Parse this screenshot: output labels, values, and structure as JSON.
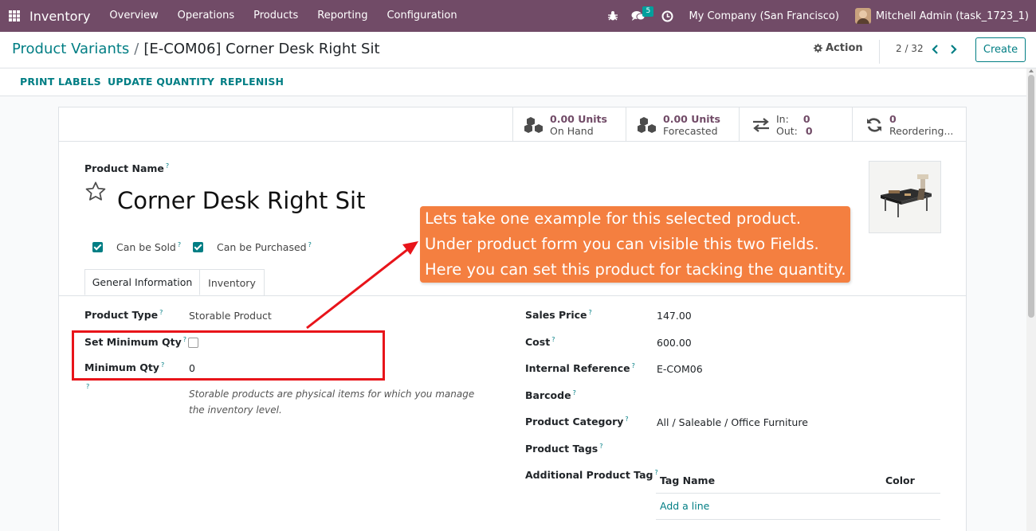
{
  "navbar": {
    "app_name": "Inventory",
    "menu": [
      "Overview",
      "Operations",
      "Products",
      "Reporting",
      "Configuration"
    ],
    "messages_count": "5",
    "company": "My Company (San Francisco)",
    "user": "Mitchell Admin (task_1723_1)"
  },
  "control_panel": {
    "breadcrumb_parent": "Product Variants",
    "breadcrumb_sep": "/",
    "breadcrumb_current": "[E-COM06] Corner Desk Right Sit",
    "action_label": "Action",
    "pager": "2 / 32",
    "create_label": "Create"
  },
  "statusbar": {
    "buttons": [
      "PRINT LABELS",
      "UPDATE QUANTITY",
      "REPLENISH"
    ]
  },
  "smart_buttons": {
    "on_hand_value": "0.00 Units",
    "on_hand_label": "On Hand",
    "forecasted_value": "0.00 Units",
    "forecasted_label": "Forecasted",
    "in_label": "In:",
    "in_value": "0",
    "out_label": "Out:",
    "out_value": "0",
    "reordering_value": "0",
    "reordering_label": "Reordering..."
  },
  "form": {
    "product_name_label": "Product Name",
    "product_name": "Corner Desk Right Sit",
    "can_be_sold_label": "Can be Sold",
    "can_be_purchased_label": "Can be Purchased",
    "tabs": [
      "General Information",
      "Inventory"
    ],
    "product_type_label": "Product Type",
    "product_type": "Storable Product",
    "set_min_qty_label": "Set Minimum Qty",
    "min_qty_label": "Minimum Qty",
    "min_qty": "0",
    "help_text": "Storable products are physical items for which you manage the inventory level.",
    "sales_price_label": "Sales Price",
    "sales_price": "147.00",
    "cost_label": "Cost",
    "cost": "600.00",
    "internal_ref_label": "Internal Reference",
    "internal_ref": "E-COM06",
    "barcode_label": "Barcode",
    "category_label": "Product Category",
    "category": "All / Saleable / Office Furniture",
    "tags_label": "Product Tags",
    "additional_tag_label": "Additional Product Tag",
    "tag_col_name": "Tag Name",
    "tag_col_color": "Color",
    "add_line": "Add a line",
    "help_marker": "?"
  },
  "annotation": {
    "line1": "Lets take one example for this selected product.",
    "line2": "Under product form you can visible this two Fields.",
    "line3": "Here you can set this product for tacking the quantity."
  },
  "colors": {
    "navbar": "#714b67",
    "accent": "#017e84",
    "callout": "#f47f40",
    "highlight": "#e8141a"
  }
}
